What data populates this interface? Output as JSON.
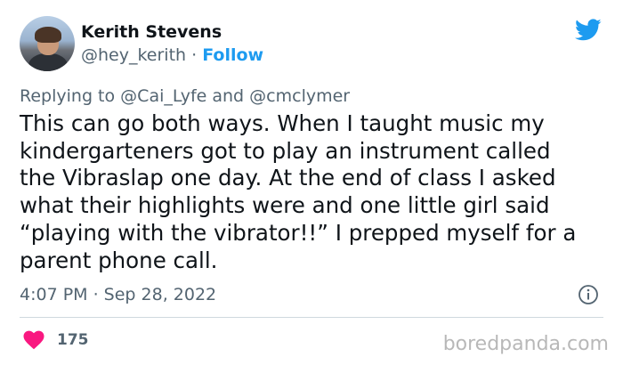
{
  "tweet": {
    "author": {
      "name": "Kerith Stevens",
      "handle": "@hey_kerith",
      "separator": "·",
      "follow_label": "Follow"
    },
    "replying_prefix": "Replying to",
    "reply_mentions": [
      "@Cai_Lyfe",
      "@cmclymer"
    ],
    "reply_conjunction": "and",
    "text_lines": [
      "This can go both ways. When I taught music my",
      "kindergarteners got to play an instrument called",
      "the Vibraslap one day. At the end of class I asked",
      "what their highlights were and one little girl said",
      "“playing with the vibrator!!” I prepped myself for a",
      "parent phone call."
    ],
    "timestamp": "4:07 PM · Sep 28, 2022",
    "like_count": "175"
  },
  "icons": {
    "brand": "twitter-bird-icon",
    "info": "info-icon",
    "like": "heart-icon"
  },
  "colors": {
    "accent": "#1d9bf0",
    "heart": "#f91880",
    "secondary_text": "#536471",
    "primary_text": "#0f1419"
  },
  "watermark": "boredpanda.com"
}
